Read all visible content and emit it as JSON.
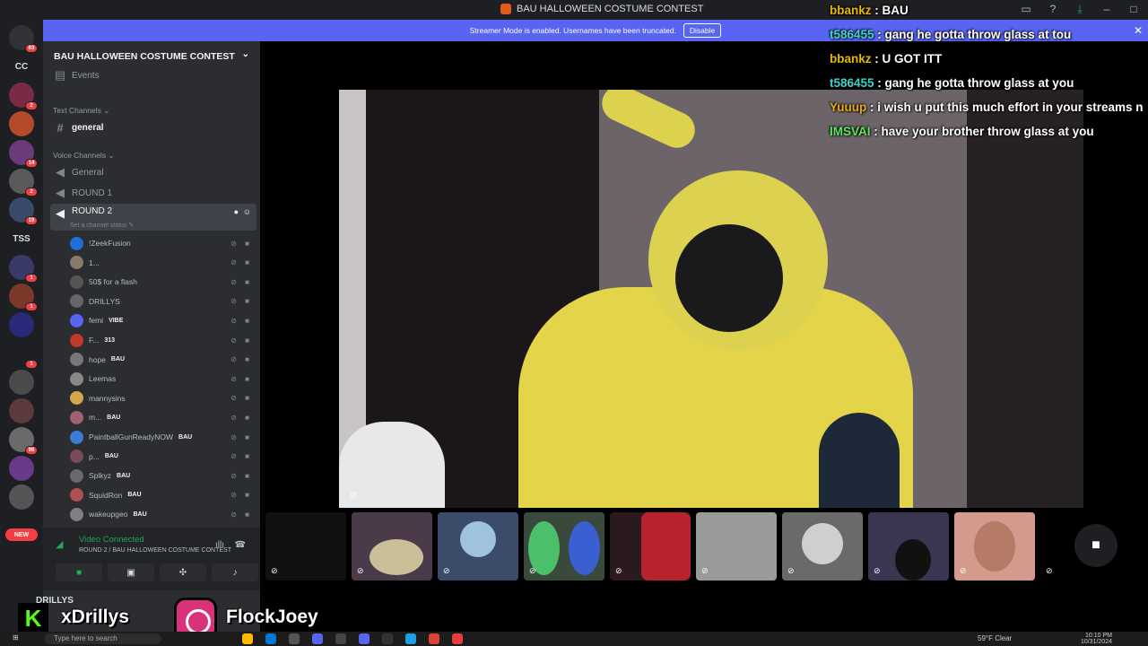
{
  "window": {
    "title": "BAU HALLOWEEN COSTUME CONTEST"
  },
  "banner": {
    "text": "Streamer Mode is enabled. Usernames have been truncated.",
    "button": "Disable"
  },
  "rail": {
    "servers": [
      {
        "label": "",
        "badge": "63"
      },
      {
        "label": "CC",
        "badge": ""
      },
      {
        "label": "",
        "badge": "2"
      },
      {
        "label": "",
        "badge": ""
      },
      {
        "label": "",
        "badge": "14"
      },
      {
        "label": "",
        "badge": "2"
      },
      {
        "label": "",
        "badge": "19"
      },
      {
        "label": "TSS",
        "badge": ""
      },
      {
        "label": "",
        "badge": "1"
      },
      {
        "label": "",
        "badge": "1"
      },
      {
        "label": "",
        "badge": ""
      },
      {
        "label": "",
        "badge": "1"
      },
      {
        "label": "",
        "badge": ""
      },
      {
        "label": "",
        "badge": ""
      },
      {
        "label": "",
        "badge": "98"
      },
      {
        "label": "",
        "badge": ""
      },
      {
        "label": "",
        "badge": ""
      }
    ],
    "new_label": "NEW"
  },
  "sidebar": {
    "server_name": "BAU HALLOWEEN COSTUME CONTEST",
    "events": "Events",
    "text_category": "Text Channels",
    "general_text": "general",
    "voice_category": "Voice Channels",
    "voice_general": "General",
    "round1": "ROUND 1",
    "round2": "ROUND 2",
    "round2_status": "Set a channel status",
    "members": [
      {
        "name": "!ZeekFusion",
        "tag": ""
      },
      {
        "name": "1...",
        "tag": ""
      },
      {
        "name": "50$ for a flash",
        "tag": ""
      },
      {
        "name": "DRILLYS",
        "tag": ""
      },
      {
        "name": "femi",
        "tag": "VIBE"
      },
      {
        "name": "F...",
        "tag": "313"
      },
      {
        "name": "hope",
        "tag": "BAU"
      },
      {
        "name": "Leemas",
        "tag": ""
      },
      {
        "name": "mannysins",
        "tag": ""
      },
      {
        "name": "m...",
        "tag": "BAU"
      },
      {
        "name": "PaintballGunReadyNOW",
        "tag": "BAU"
      },
      {
        "name": "p...",
        "tag": "BAU"
      },
      {
        "name": "Splkyz",
        "tag": "BAU"
      },
      {
        "name": "SquidRon",
        "tag": "BAU"
      },
      {
        "name": "wakeupgeo",
        "tag": "BAU"
      }
    ],
    "member_colors": [
      "#1e6fd9",
      "#8a7a6a",
      "#555",
      "#666",
      "#5865f2",
      "#c0392b",
      "#777",
      "#888",
      "#d4a84a",
      "#a06070",
      "#3a7bd5",
      "#7a4a5a",
      "#6a6a6a",
      "#b05050",
      "#808080"
    ]
  },
  "voice": {
    "status": "Video Connected",
    "channel": "ROUND 2 / BAU HALLOWEEN COSTUME CONTEST"
  },
  "user_panel": {
    "name": "DRILLYS"
  },
  "chat": [
    {
      "user": "bbankz",
      "sep": " : ",
      "msg": "BAU",
      "color": "#e6b800"
    },
    {
      "user": "t586455",
      "sep": " : ",
      "msg": "gang he gotta throw glass at tou",
      "color": "#3fd2c7"
    },
    {
      "user": "bbankz",
      "sep": " : ",
      "msg": "U GOT ITT",
      "color": "#e6b800"
    },
    {
      "user": "t586455",
      "sep": " : ",
      "msg": "gang he gotta throw glass at you",
      "color": "#3fd2c7"
    },
    {
      "user": "Yuuup",
      "sep": " : ",
      "msg": "i wish u put this much effort in your streams n",
      "color": "#e6a817"
    },
    {
      "user": "IMSVAI",
      "sep": " : ",
      "msg": "have your brother throw glass at you",
      "color": "#5ce65c"
    }
  ],
  "social": {
    "kick": "xDrillys",
    "instagram": "FlockJoey"
  },
  "taskbar": {
    "search": "Type here to search",
    "weather": "59°F  Clear",
    "time": "10:10 PM",
    "date": "10/31/2024"
  }
}
